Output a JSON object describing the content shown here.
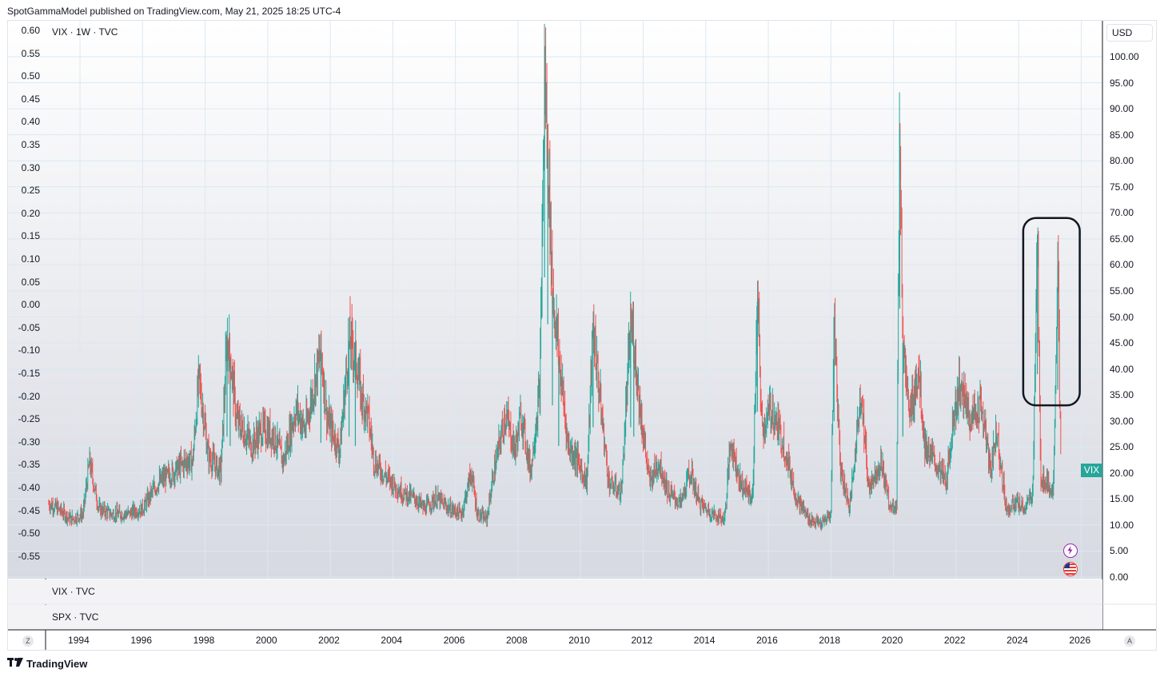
{
  "publisher_line": "SpotGammaModel published on TradingView.com, May 21, 2025 18:25 UTC-4",
  "legend": {
    "main": "VIX · 1W · TVC",
    "pane1": "VIX · TVC",
    "pane2": "SPX · TVC"
  },
  "currency_label": "USD",
  "last_value_tag": "VIX",
  "footer_brand": "TradingView",
  "corner_buttons": {
    "left": "Z",
    "right": "A"
  },
  "icons": [
    "lightning-icon",
    "us-flag-icon",
    "tradingview-logo-icon"
  ],
  "colors": {
    "up": "#26a69a",
    "down": "#ef5350",
    "grid": "#dbe8f2",
    "highlight_box": "#131722"
  },
  "chart_data": {
    "type": "bar",
    "title": "VIX · 1W · TVC",
    "x_ticks": [
      "1994",
      "1996",
      "1998",
      "2000",
      "2002",
      "2004",
      "2006",
      "2008",
      "2010",
      "2012",
      "2014",
      "2016",
      "2018",
      "2020",
      "2022",
      "2024",
      "2026"
    ],
    "left_ticks": [
      "0.60",
      "0.55",
      "0.50",
      "0.45",
      "0.40",
      "0.35",
      "0.30",
      "0.25",
      "0.20",
      "0.15",
      "0.10",
      "0.05",
      "0.00",
      "-0.05",
      "-0.10",
      "-0.15",
      "-0.20",
      "-0.25",
      "-0.30",
      "-0.35",
      "-0.40",
      "-0.45",
      "-0.50",
      "-0.55"
    ],
    "right_ticks": [
      "100.00",
      "95.00",
      "90.00",
      "85.00",
      "80.00",
      "75.00",
      "70.00",
      "65.00",
      "60.00",
      "55.00",
      "50.00",
      "45.00",
      "40.00",
      "35.00",
      "30.00",
      "25.00",
      "20.00",
      "15.00",
      "10.00",
      "5.00",
      "0.00"
    ],
    "xlim": [
      1992.9,
      2026.5
    ],
    "ylim": [
      0,
      100
    ],
    "last_value": 21.0,
    "highlight_region": {
      "x": [
        2024.3,
        2025.8
      ],
      "y": [
        33,
        69
      ]
    },
    "series": [
      {
        "note": "weekly VIX levels, approximate key points",
        "points": [
          [
            1993.0,
            14
          ],
          [
            1993.3,
            13
          ],
          [
            1993.7,
            11
          ],
          [
            1994.1,
            12
          ],
          [
            1994.3,
            22
          ],
          [
            1994.6,
            13
          ],
          [
            1995.0,
            12
          ],
          [
            1995.5,
            12
          ],
          [
            1996.0,
            13
          ],
          [
            1996.5,
            18
          ],
          [
            1997.0,
            20
          ],
          [
            1997.4,
            22
          ],
          [
            1997.6,
            22
          ],
          [
            1997.8,
            38
          ],
          [
            1998.1,
            23
          ],
          [
            1998.5,
            20
          ],
          [
            1998.7,
            45
          ],
          [
            1998.8,
            42
          ],
          [
            1999.0,
            30
          ],
          [
            1999.5,
            25
          ],
          [
            1999.8,
            28
          ],
          [
            2000.2,
            27
          ],
          [
            2000.5,
            22
          ],
          [
            2000.9,
            32
          ],
          [
            2001.2,
            28
          ],
          [
            2001.7,
            43
          ],
          [
            2001.9,
            30
          ],
          [
            2002.3,
            24
          ],
          [
            2002.6,
            45
          ],
          [
            2002.8,
            42
          ],
          [
            2003.0,
            34
          ],
          [
            2003.2,
            31
          ],
          [
            2003.4,
            22
          ],
          [
            2003.8,
            19
          ],
          [
            2004.3,
            16
          ],
          [
            2004.7,
            15
          ],
          [
            2005.0,
            13
          ],
          [
            2005.4,
            15
          ],
          [
            2005.8,
            13
          ],
          [
            2006.2,
            12
          ],
          [
            2006.5,
            20
          ],
          [
            2006.7,
            12
          ],
          [
            2007.0,
            11
          ],
          [
            2007.2,
            19
          ],
          [
            2007.6,
            31
          ],
          [
            2007.9,
            24
          ],
          [
            2008.1,
            31
          ],
          [
            2008.4,
            20
          ],
          [
            2008.7,
            36
          ],
          [
            2008.85,
            96
          ],
          [
            2008.95,
            81
          ],
          [
            2009.1,
            55
          ],
          [
            2009.3,
            42
          ],
          [
            2009.6,
            25
          ],
          [
            2009.9,
            22
          ],
          [
            2010.2,
            18
          ],
          [
            2010.4,
            48
          ],
          [
            2010.6,
            35
          ],
          [
            2010.9,
            18
          ],
          [
            2011.3,
            16
          ],
          [
            2011.6,
            48
          ],
          [
            2011.7,
            45
          ],
          [
            2011.9,
            32
          ],
          [
            2012.2,
            18
          ],
          [
            2012.5,
            22
          ],
          [
            2012.8,
            16
          ],
          [
            2013.2,
            14
          ],
          [
            2013.5,
            20
          ],
          [
            2013.8,
            14
          ],
          [
            2014.2,
            12
          ],
          [
            2014.6,
            11
          ],
          [
            2014.8,
            26
          ],
          [
            2015.1,
            18
          ],
          [
            2015.5,
            15
          ],
          [
            2015.65,
            53
          ],
          [
            2015.8,
            28
          ],
          [
            2016.1,
            32
          ],
          [
            2016.5,
            25
          ],
          [
            2016.9,
            15
          ],
          [
            2017.3,
            11
          ],
          [
            2017.7,
            10
          ],
          [
            2018.0,
            12
          ],
          [
            2018.1,
            50
          ],
          [
            2018.3,
            21
          ],
          [
            2018.6,
            13
          ],
          [
            2018.8,
            25
          ],
          [
            2018.95,
            36
          ],
          [
            2019.2,
            17
          ],
          [
            2019.6,
            22
          ],
          [
            2019.9,
            13
          ],
          [
            2020.1,
            14
          ],
          [
            2020.2,
            86
          ],
          [
            2020.3,
            45
          ],
          [
            2020.5,
            30
          ],
          [
            2020.8,
            40
          ],
          [
            2021.0,
            25
          ],
          [
            2021.3,
            22
          ],
          [
            2021.7,
            18
          ],
          [
            2021.9,
            30
          ],
          [
            2022.1,
            36
          ],
          [
            2022.5,
            30
          ],
          [
            2022.8,
            33
          ],
          [
            2023.1,
            20
          ],
          [
            2023.3,
            28
          ],
          [
            2023.6,
            13
          ],
          [
            2023.9,
            14
          ],
          [
            2024.2,
            13
          ],
          [
            2024.45,
            16
          ],
          [
            2024.6,
            65
          ],
          [
            2024.7,
            19
          ],
          [
            2024.9,
            18
          ],
          [
            2025.1,
            16
          ],
          [
            2025.25,
            60
          ],
          [
            2025.3,
            38
          ],
          [
            2025.35,
            21
          ]
        ]
      }
    ]
  }
}
